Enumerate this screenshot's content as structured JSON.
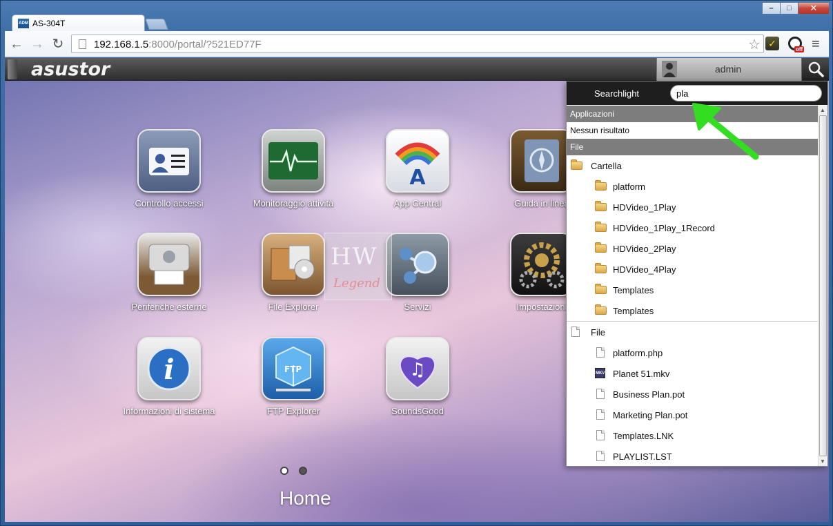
{
  "browser": {
    "tab_title": "AS-304T",
    "favicon_text": "ADM",
    "url_host": "192.168.1.5",
    "url_rest": ":8000/portal/?521ED77F",
    "ext_badge": "off"
  },
  "topbar": {
    "brand": "asustor",
    "user": "admin"
  },
  "apps": [
    {
      "label": "Controllo accessi",
      "icon": "id-card-icon"
    },
    {
      "label": "Monitoraggio attività",
      "icon": "heartbeat-monitor-icon"
    },
    {
      "label": "App Central",
      "icon": "app-central-icon"
    },
    {
      "label": "Guida in linea",
      "icon": "compass-book-icon"
    },
    {
      "label": "Periferiche esterne",
      "icon": "printer-icon"
    },
    {
      "label": "File Explorer",
      "icon": "file-cabinet-icon"
    },
    {
      "label": "Servizi",
      "icon": "services-icon"
    },
    {
      "label": "Impostazioni",
      "icon": "gears-icon"
    },
    {
      "label": "Informazioni di sistema",
      "icon": "info-icon"
    },
    {
      "label": "FTP Explorer",
      "icon": "ftp-box-icon"
    },
    {
      "label": "SoundsGood",
      "icon": "music-heart-icon"
    }
  ],
  "home_label": "Home",
  "watermark": {
    "main": "HW",
    "sub": "Legend"
  },
  "searchlight": {
    "title": "Searchlight",
    "query": "pla",
    "sections": {
      "apps": "Applicazioni",
      "no_results": "Nessun risultato",
      "files": "File"
    },
    "folder_group": "Cartella",
    "folders": [
      "platform",
      "HDVideo_1Play",
      "HDVideo_1Play_1Record",
      "HDVideo_2Play",
      "HDVideo_4Play",
      "Templates",
      "Templates"
    ],
    "file_group": "File",
    "files": [
      "platform.php",
      "Planet 51.mkv",
      "Business Plan.pot",
      "Marketing Plan.pot",
      "Templates.LNK",
      "PLAYLIST.LST"
    ]
  },
  "colors": {
    "annotation_arrow": "#33dd22",
    "section_header": "#7d7d7d",
    "topbar": "#2e2e2e"
  }
}
